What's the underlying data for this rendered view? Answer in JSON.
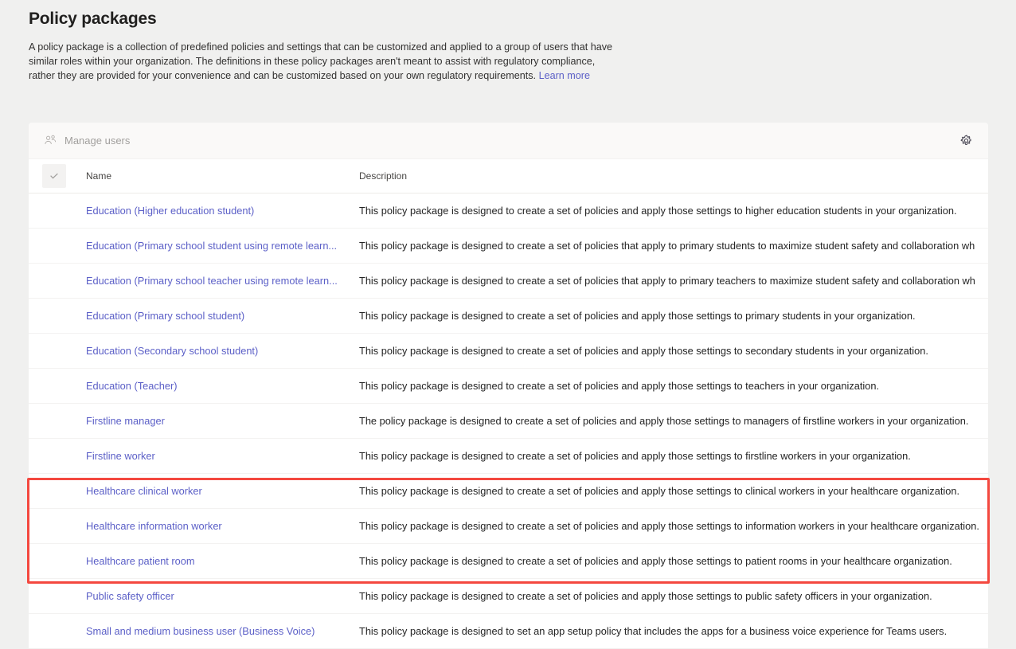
{
  "page": {
    "title": "Policy packages",
    "description_part1": "A policy package is a collection of predefined policies and settings that can be customized and applied to a group of users that have similar roles within your organization. The definitions in these policy packages aren't meant to assist with regulatory compliance, rather they are provided for your convenience and can be customized based on your own regulatory requirements. ",
    "learn_more": "Learn more"
  },
  "command_bar": {
    "manage_users_label": "Manage users",
    "manage_users_icon": "people-icon",
    "settings_icon": "gear-icon"
  },
  "table": {
    "columns": {
      "name": "Name",
      "description": "Description"
    },
    "select_all_icon": "checkmark-icon",
    "rows": [
      {
        "name": "Education (Higher education student)",
        "description": "This policy package is designed to create a set of policies and apply those settings to higher education students in your organization."
      },
      {
        "name": "Education (Primary school student using remote learn...",
        "description": "This policy package is designed to create a set of policies that apply to primary students to maximize student safety and collaboration wh"
      },
      {
        "name": "Education (Primary school teacher using remote learn...",
        "description": "This policy package is designed to create a set of policies that apply to primary teachers to maximize student safety and collaboration wh"
      },
      {
        "name": "Education (Primary school student)",
        "description": "This policy package is designed to create a set of policies and apply those settings to primary students in your organization."
      },
      {
        "name": "Education (Secondary school student)",
        "description": "This policy package is designed to create a set of policies and apply those settings to secondary students in your organization."
      },
      {
        "name": "Education (Teacher)",
        "description": "This policy package is designed to create a set of policies and apply those settings to teachers in your organization."
      },
      {
        "name": "Firstline manager",
        "description": "The policy package is designed to create a set of policies and apply those settings to managers of firstline workers in your organization."
      },
      {
        "name": "Firstline worker",
        "description": "This policy package is designed to create a set of policies and apply those settings to firstline workers in your organization."
      },
      {
        "name": "Healthcare clinical worker",
        "description": "This policy package is designed to create a set of policies and apply those settings to clinical workers in your healthcare organization."
      },
      {
        "name": "Healthcare information worker",
        "description": "This policy package is designed to create a set of policies and apply those settings to information workers in your healthcare organization."
      },
      {
        "name": "Healthcare patient room",
        "description": "This policy package is designed to create a set of policies and apply those settings to patient rooms in your healthcare organization."
      },
      {
        "name": "Public safety officer",
        "description": "This policy package is designed to create a set of policies and apply those settings to public safety officers in your organization."
      },
      {
        "name": "Small and medium business user (Business Voice)",
        "description": "This policy package is designed to set an app setup policy that includes the apps for a business voice experience for Teams users."
      }
    ]
  },
  "annotation": {
    "highlight_color": "#f4483f",
    "highlight_rows": [
      "Healthcare clinical worker",
      "Healthcare information worker",
      "Healthcare patient room"
    ]
  },
  "colors": {
    "link": "#5b5fc7",
    "page_background": "#f0f0ef",
    "card_background": "#ffffff"
  }
}
